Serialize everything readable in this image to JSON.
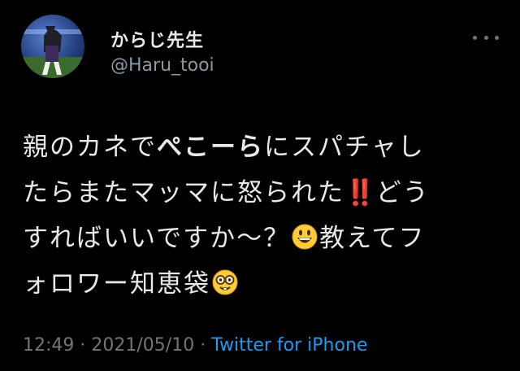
{
  "user": {
    "name": "からじ先生",
    "handle": "@Haru_tooi"
  },
  "tweet": {
    "line1_a": "親のカネで",
    "line1_bold": "ぺこーら",
    "line1_b": "にスパチャし",
    "line2_a": "たらまたマッマに怒られた",
    "line2_bang": "‼️",
    "line2_b": "どう",
    "line3_a": "すればいいですか〜？",
    "line3_b": "教えてフ",
    "line4": "ォロワー知恵袋"
  },
  "icons": {
    "more": "more-icon",
    "grin_emoji": "grinning-face-emoji",
    "nerd_emoji": "nerd-face-emoji"
  },
  "footer": {
    "time": "12:49",
    "sep1": " · ",
    "date": "2021/05/10",
    "sep2": " · ",
    "source": "Twitter for iPhone"
  },
  "colors": {
    "background": "#000000",
    "text": "#e7e9ea",
    "secondary": "#71767b",
    "link": "#1d9bf0"
  }
}
